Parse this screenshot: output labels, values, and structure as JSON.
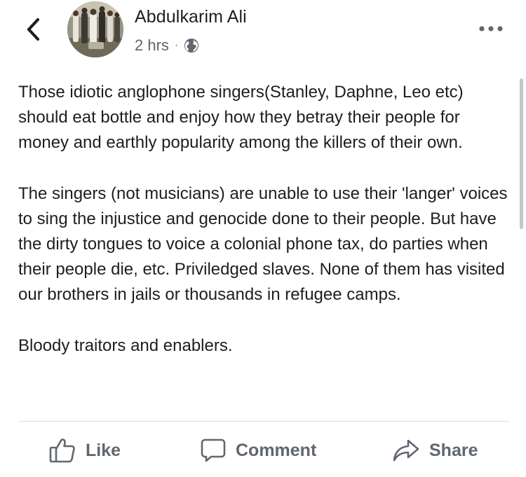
{
  "post": {
    "author": "Abdulkarim Ali",
    "time": "2 hrs",
    "separator": "·",
    "paragraphs": [
      "Those idiotic anglophone singers(Stanley, Daphne, Leo etc) should eat bottle and enjoy how they betray their people for money and earthly popularity among the killers of their own.",
      "The singers (not musicians) are unable to use their 'langer' voices to sing the injustice and genocide done to their people. But have the dirty tongues to voice a colonial phone tax, do parties when their people die, etc. Priviledged slaves. None of them has visited our brothers in jails or thousands in refugee camps.",
      "Bloody traitors and enablers."
    ]
  },
  "actions": {
    "like_label": "Like",
    "comment_label": "Comment",
    "share_label": "Share"
  },
  "icons": {
    "back": "chevron-left-icon",
    "more": "more-dots-icon",
    "privacy": "globe-icon",
    "like": "thumbs-up-icon",
    "comment": "comment-bubble-icon",
    "share": "share-arrow-icon"
  },
  "colors": {
    "text": "#1c1e21",
    "secondary": "#606770",
    "divider": "#dadde1"
  }
}
